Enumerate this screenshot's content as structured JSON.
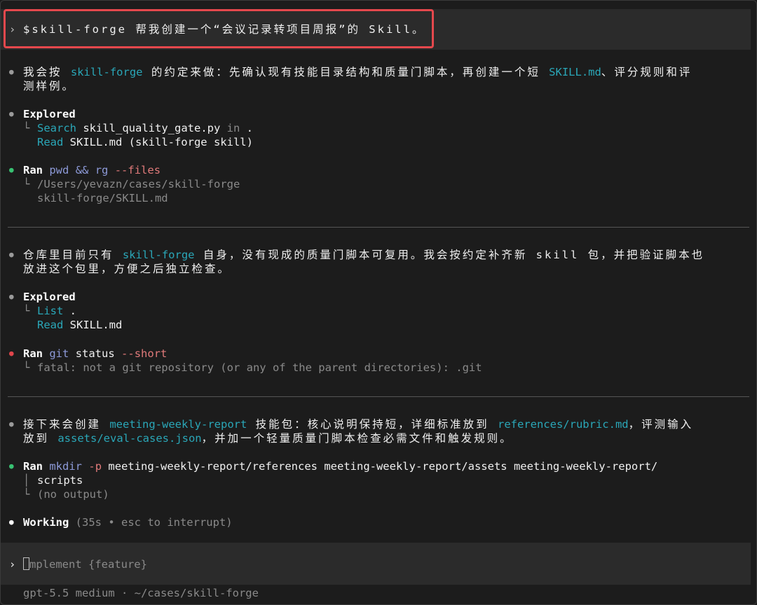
{
  "prompt": {
    "chevron": "›",
    "text": "$skill-forge 帮我创建一个“会议记录转项目周报”的 Skill。"
  },
  "block1": {
    "msg_pre": "我会按 ",
    "msg_skill": "skill-forge",
    "msg_mid": " 的约定来做：先确认现有技能目录结构和质量门脚本，再创建一个短 ",
    "msg_file": "SKILL.md",
    "msg_post": "、评分规则和评",
    "msg_line2": "测样例。",
    "explored_label": "Explored",
    "e1_verb": "Search",
    "e1_arg": "skill_quality_gate.py",
    "e1_in": "in",
    "e1_dot": ".",
    "e2_verb": "Read",
    "e2_arg": "SKILL.md (skill-forge skill)",
    "ran_label": "Ran",
    "ran_cmd1": "pwd",
    "ran_amp": "&&",
    "ran_cmd2": "rg",
    "ran_flag": "--files",
    "out1": "/Users/yevazn/cases/skill-forge",
    "out2": "skill-forge/SKILL.md"
  },
  "block2": {
    "msg_pre": "仓库里目前只有 ",
    "msg_skill": "skill-forge",
    "msg_post": " 自身，没有现成的质量门脚本可复用。我会按约定补齐新 skill 包，并把验证脚本也",
    "msg_line2": "放进这个包里，方便之后独立检查。",
    "explored_label": "Explored",
    "e1_verb": "List",
    "e1_arg": ".",
    "e2_verb": "Read",
    "e2_arg": "SKILL.md",
    "ran_label": "Ran",
    "ran_cmd": "git",
    "ran_arg": "status",
    "ran_flag": "--short",
    "out1": "fatal: not a git repository (or any of the parent directories): .git"
  },
  "block3": {
    "msg_pre": "接下来会创建 ",
    "msg_skill": "meeting-weekly-report",
    "msg_mid": " 技能包：核心说明保持短，详细标准放到 ",
    "msg_file": "references/rubric.md",
    "msg_post": "，评测输入",
    "msg_l2_pre": "放到 ",
    "msg_l2_file": "assets/eval-cases.json",
    "msg_l2_post": "，并加一个轻量质量门脚本检查必需文件和触发规则。",
    "ran_label": "Ran",
    "ran_cmd": "mkdir",
    "ran_flag": "-p",
    "ran_args": "meeting-weekly-report/references meeting-weekly-report/assets meeting-weekly-report/",
    "ran_args2": "scripts",
    "out1": "(no output)"
  },
  "working": {
    "label": "Working",
    "status": "(35s • esc to interrupt)"
  },
  "input": {
    "chevron": "›",
    "first_char": "I",
    "placeholder_rest": "mplement {feature}"
  },
  "footer": {
    "text": "gpt-5.5 medium · ~/cases/skill-forge"
  },
  "glyphs": {
    "bullet": "●",
    "branch": "└",
    "pipe": "│"
  }
}
